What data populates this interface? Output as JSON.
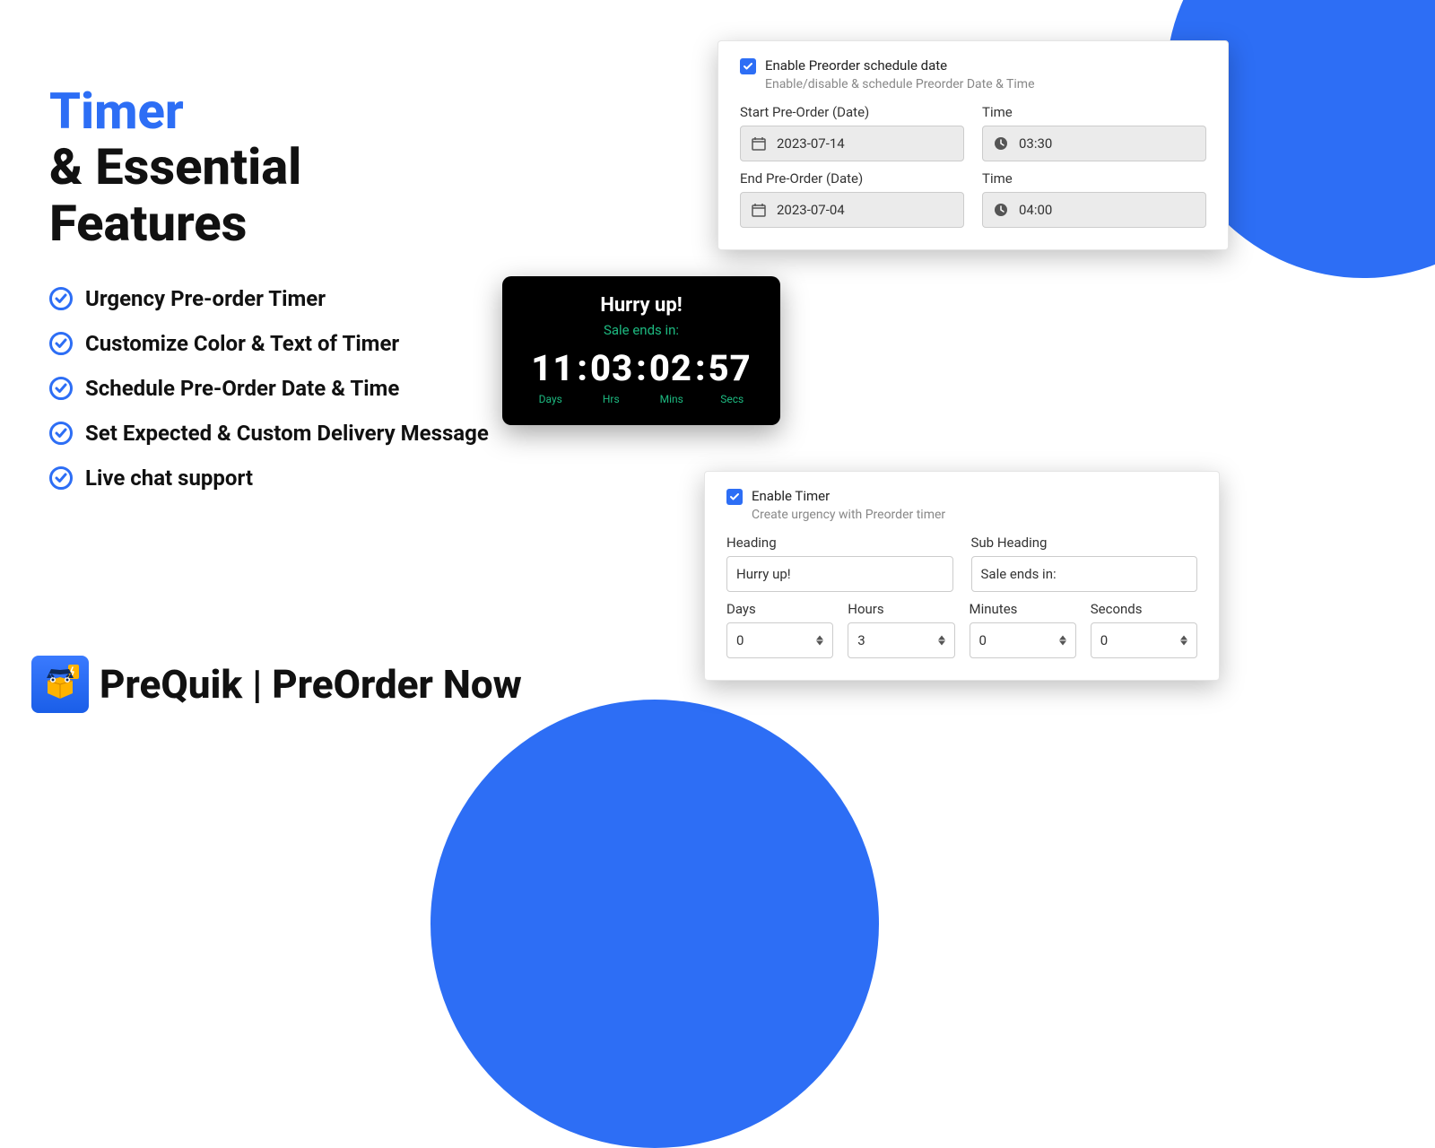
{
  "hero": {
    "line1": "Timer",
    "line2": "& Essential",
    "line3": "Features"
  },
  "features": [
    "Urgency Pre-order Timer",
    "Customize Color & Text of Timer",
    "Schedule Pre-Order Date & Time",
    "Set Expected & Custom Delivery Message",
    "Live chat support"
  ],
  "brand": "PreQuik | PreOrder Now",
  "schedule": {
    "enable_label": "Enable Preorder schedule date",
    "enable_sub": "Enable/disable & schedule Preorder Date & Time",
    "start_date_label": "Start Pre-Order (Date)",
    "start_date_value": "2023-07-14",
    "start_time_label": "Time",
    "start_time_value": "03:30",
    "end_date_label": "End Pre-Order (Date)",
    "end_date_value": "2023-07-04",
    "end_time_label": "Time",
    "end_time_value": "04:00"
  },
  "timer_widget": {
    "heading": "Hurry up!",
    "sub": "Sale ends in:",
    "days": "11",
    "hrs": "03",
    "mins": "02",
    "secs": "57",
    "l_days": "Days",
    "l_hrs": "Hrs",
    "l_mins": "Mins",
    "l_secs": "Secs"
  },
  "timer_settings": {
    "enable_label": "Enable Timer",
    "enable_sub": "Create urgency with Preorder timer",
    "heading_label": "Heading",
    "heading_value": "Hurry up!",
    "sub_label": "Sub Heading",
    "sub_value": "Sale ends in:",
    "days_label": "Days",
    "days_value": "0",
    "hours_label": "Hours",
    "hours_value": "3",
    "minutes_label": "Minutes",
    "minutes_value": "0",
    "seconds_label": "Seconds",
    "seconds_value": "0"
  }
}
